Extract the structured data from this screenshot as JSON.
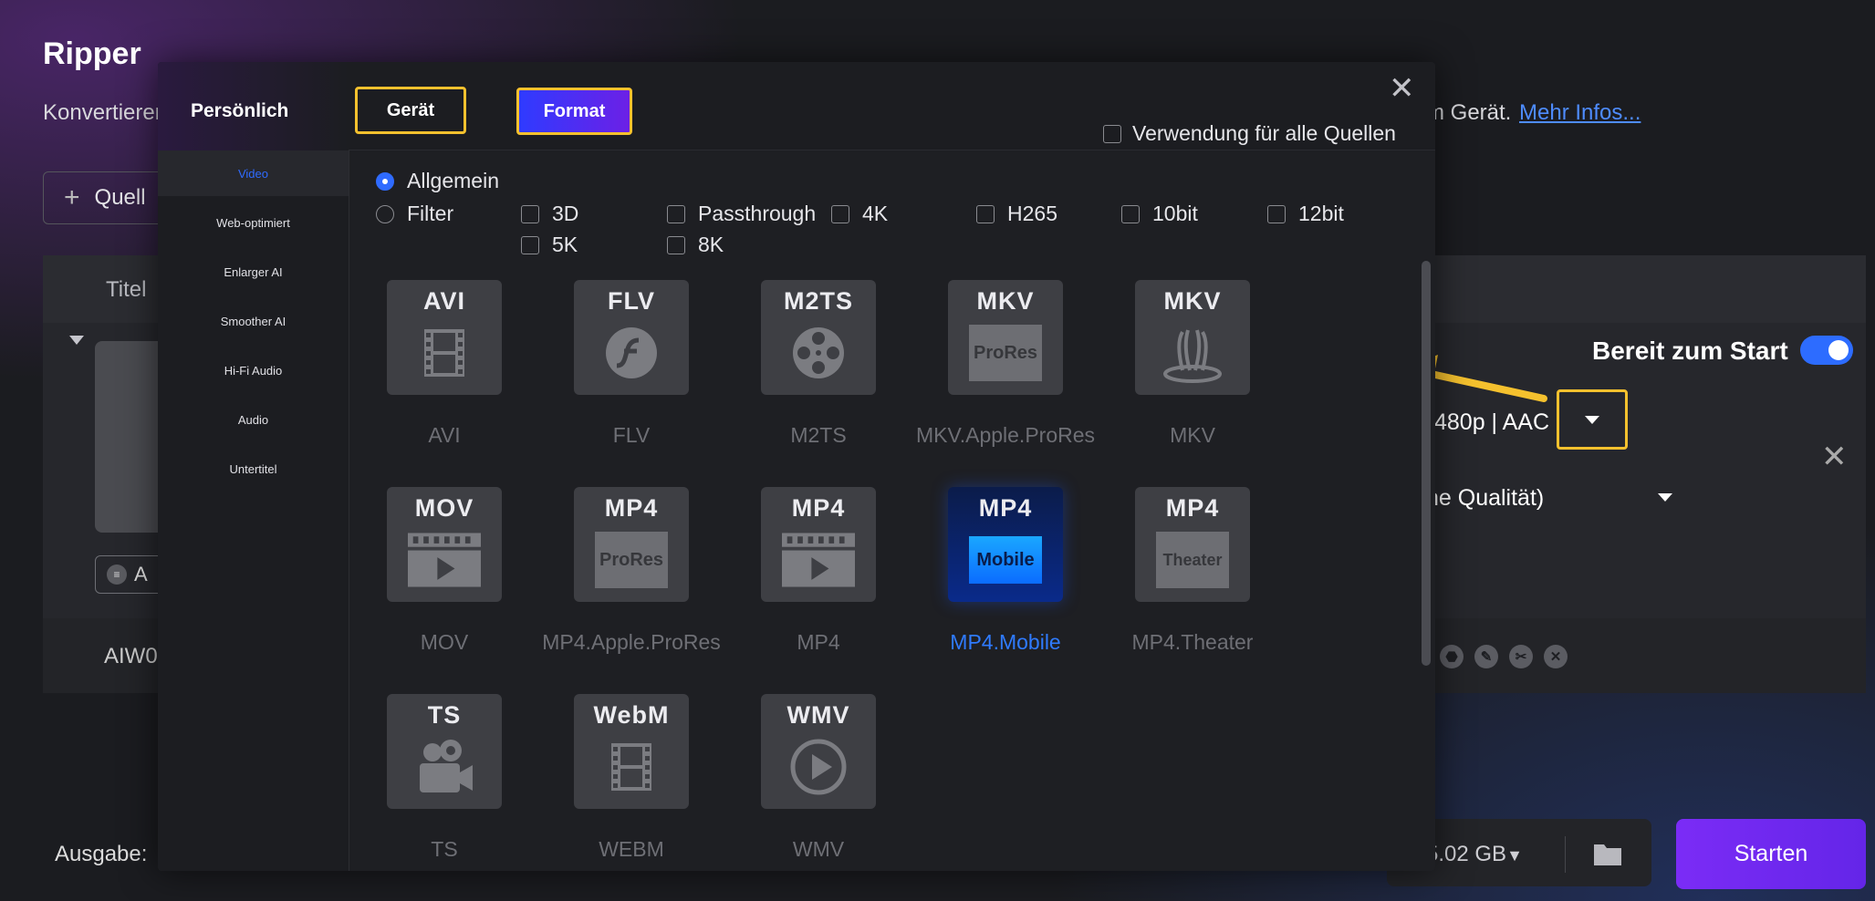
{
  "app": {
    "title": "Ripper",
    "description_left": "Konvertieren",
    "description_right": "m Gerät.",
    "more_info": "Mehr Infos...",
    "add_source": "Quell",
    "column_title": "Titel",
    "audio_chip": "A",
    "file_name": "AIW0",
    "ready_label": "Bereit zum Start",
    "ready_enabled": true,
    "preset": "480p | AAC",
    "quality": "ne Qualität)",
    "output_label": "Ausgabe:",
    "output_size": "5.02 GB",
    "start_button": "Starten"
  },
  "dialog": {
    "personal_label": "Persönlich",
    "tab_device": "Gerät",
    "tab_format": "Format",
    "apply_all": "Verwendung für alle Quellen",
    "side_items": [
      "Video",
      "Web-optimiert",
      "Enlarger AI",
      "Smoother AI",
      "Hi-Fi Audio",
      "Audio",
      "Untertitel"
    ],
    "active_side_item": "Video",
    "general_option": "Allgemein",
    "filter_option": "Filter",
    "filters": [
      "3D",
      "Passthrough",
      "4K",
      "H265",
      "10bit",
      "12bit",
      "5K",
      "8K"
    ],
    "formats": [
      {
        "tag": "AVI",
        "name": "AVI",
        "icon": "film-strip-icon"
      },
      {
        "tag": "FLV",
        "name": "FLV",
        "icon": "flash-icon"
      },
      {
        "tag": "M2TS",
        "name": "M2TS",
        "icon": "film-reel-icon"
      },
      {
        "tag": "MKV",
        "name": "MKV.Apple.ProRes",
        "icon": "prores-label-icon",
        "badge": "ProRes"
      },
      {
        "tag": "MKV",
        "name": "MKV",
        "icon": "matroska-icon"
      },
      {
        "tag": "MOV",
        "name": "MOV",
        "icon": "play-clapper-icon"
      },
      {
        "tag": "MP4",
        "name": "MP4.Apple.ProRes",
        "icon": "prores-label-icon",
        "badge": "ProRes"
      },
      {
        "tag": "MP4",
        "name": "MP4",
        "icon": "play-clapper-icon"
      },
      {
        "tag": "MP4",
        "name": "MP4.Mobile",
        "icon": "mobile-label-icon",
        "badge": "Mobile"
      },
      {
        "tag": "MP4",
        "name": "MP4.Theater",
        "icon": "theater-label-icon",
        "badge": "Theater"
      },
      {
        "tag": "TS",
        "name": "TS",
        "icon": "camera-icon"
      },
      {
        "tag": "WebM",
        "name": "WEBM",
        "icon": "film-strip-icon"
      },
      {
        "tag": "WMV",
        "name": "WMV",
        "icon": "play-circle-icon"
      }
    ],
    "selected_format": "MP4.Mobile"
  },
  "colors": {
    "accent": "#2f6bff",
    "highlight": "#f5c12e",
    "start_gradient": "#7b2cf6"
  }
}
